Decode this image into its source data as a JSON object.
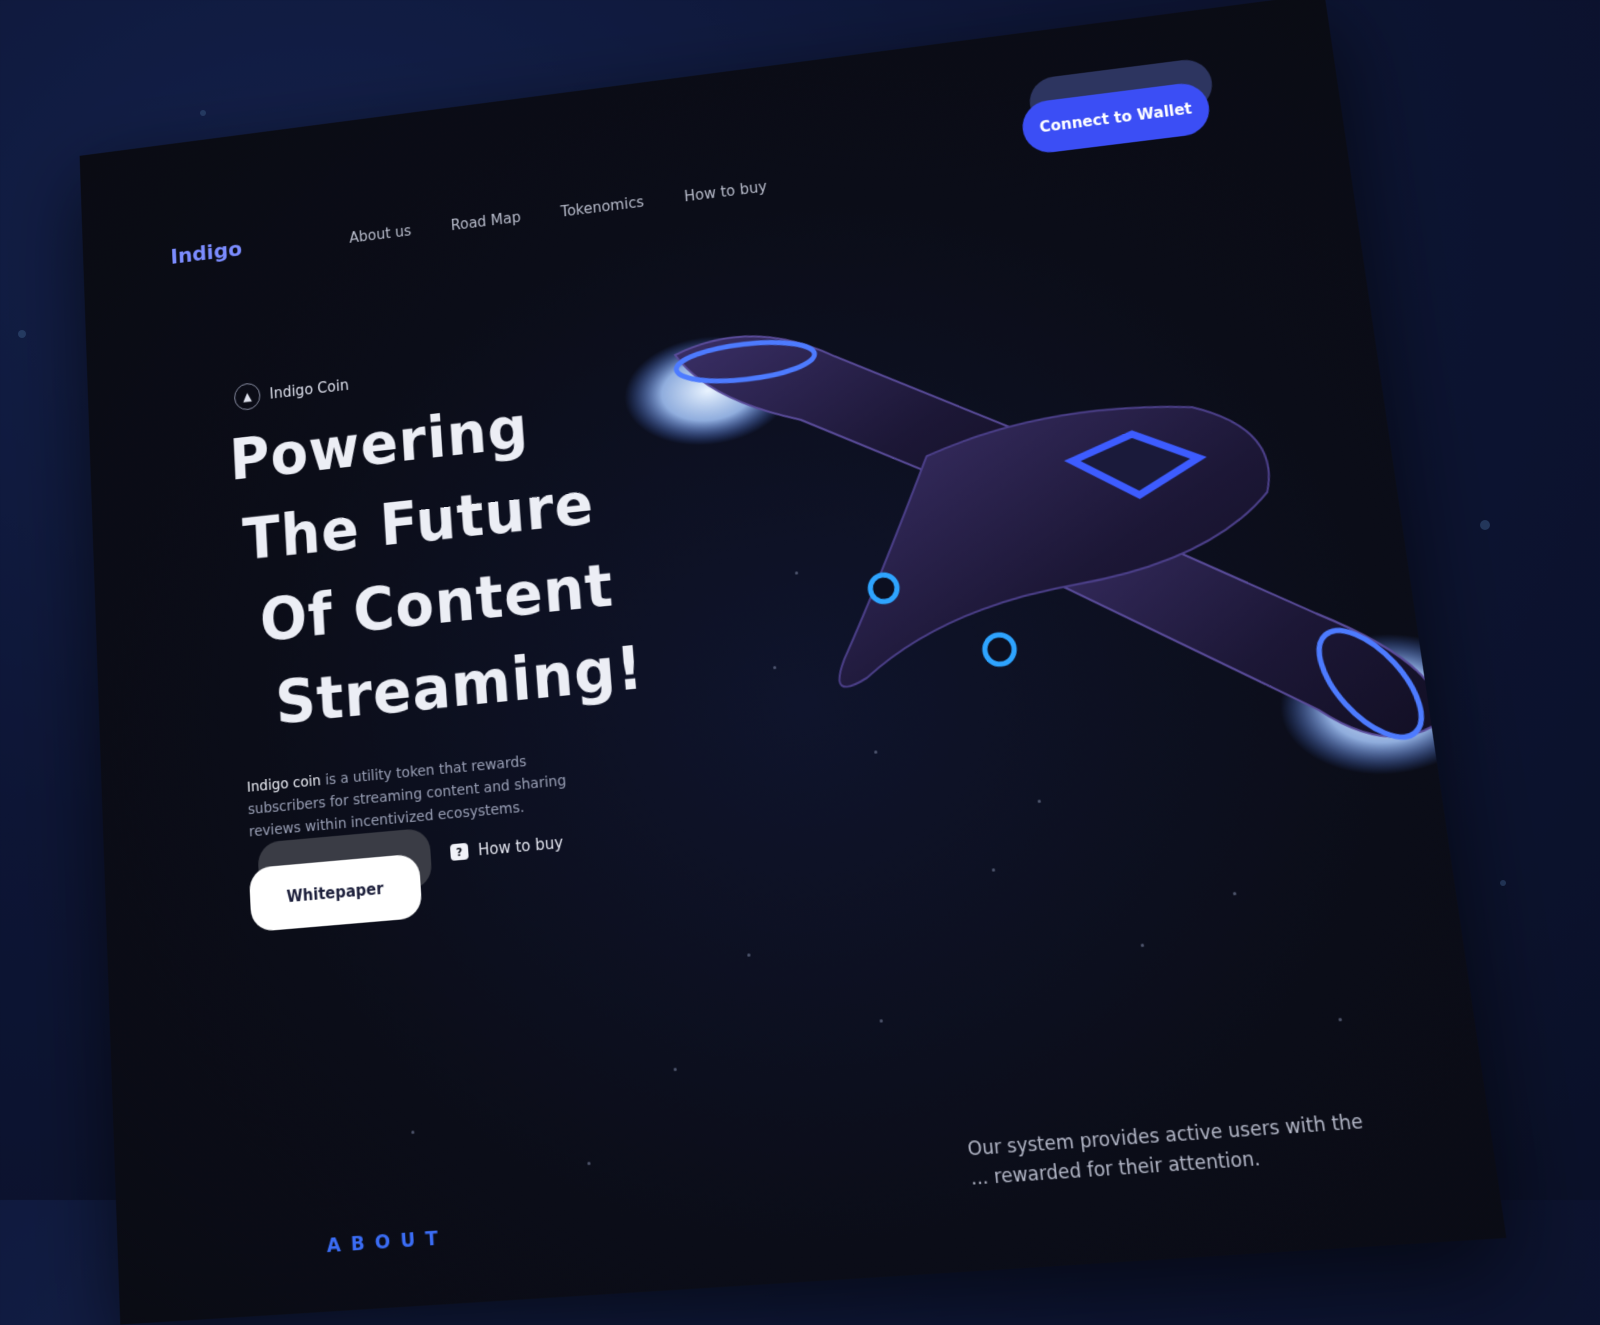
{
  "brand": {
    "logo_text": "Indigo"
  },
  "nav": {
    "items": [
      "About us",
      "Road Map",
      "Tokenomics",
      "How to buy"
    ]
  },
  "header": {
    "cta_label": "Connect to Wallet"
  },
  "hero": {
    "badge_text": "Indigo Coin",
    "headline_lines": [
      "Powering",
      "The Future",
      "Of Content",
      "Streaming!"
    ],
    "description_highlight": "Indigo coin",
    "description_rest": " is a utility token that rewards subscribers for streaming content and sharing reviews within incentivized ecosystems.",
    "primary_button_label": "Whitepaper",
    "secondary_link_label": "How to buy"
  },
  "about": {
    "section_label": "ABOUT",
    "text": "Our system provides active users with the ... rewarded for their attention."
  },
  "colors": {
    "accent": "#3b4ef5",
    "background": "#0b0d18",
    "glow": "#4a7dff"
  }
}
